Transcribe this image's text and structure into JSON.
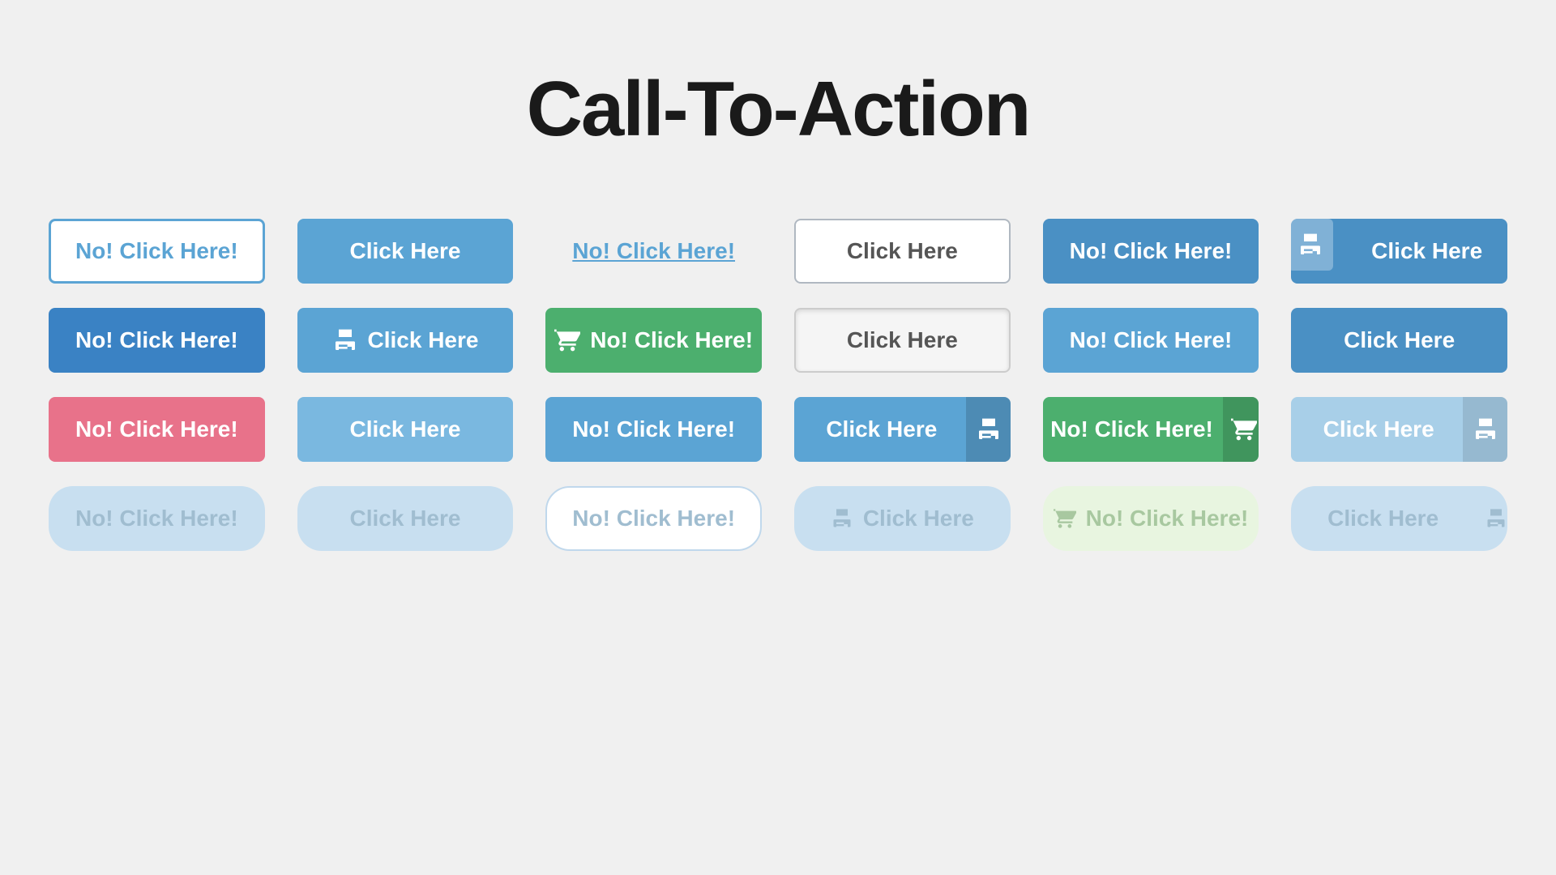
{
  "title": "Call-To-Action",
  "buttons": {
    "no_click": "No! Click Here!",
    "click_here": "Click Here"
  },
  "icons": {
    "print": "🖨",
    "cart": "🛒"
  }
}
